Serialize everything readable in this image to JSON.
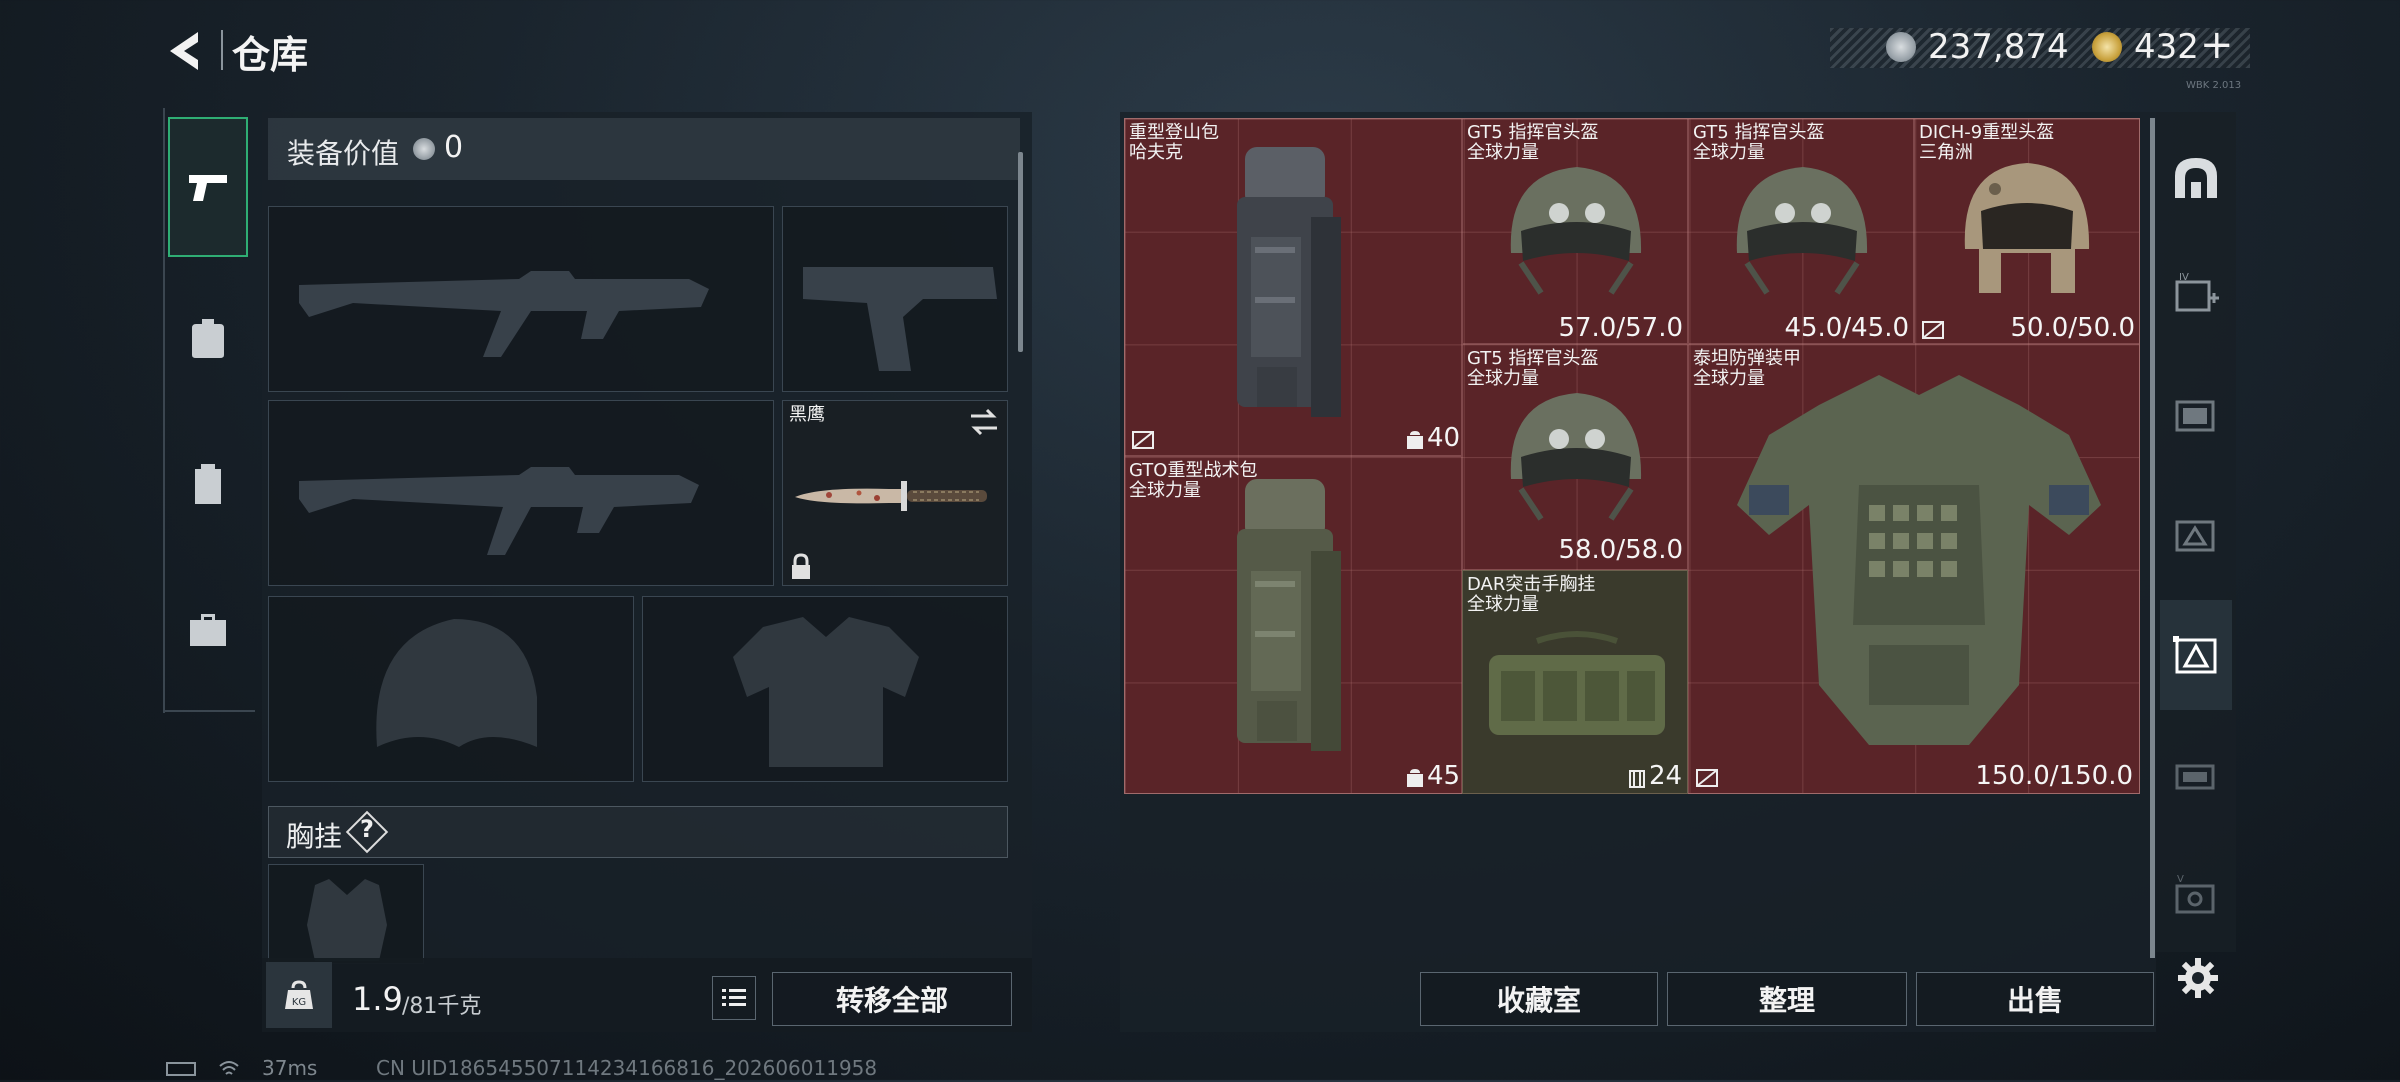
{
  "header": {
    "title": "仓库",
    "currency1": "237,874",
    "currency2": "432",
    "add_symbol": "+",
    "version_text": "WBK 2.013"
  },
  "loadout": {
    "equipment_value_label": "装备价值",
    "equipment_value": "0",
    "knife_name": "黑鹰",
    "chest_rig_label": "胸挂",
    "help_symbol": "?"
  },
  "weight": {
    "current": "1.9",
    "max": "/81千克"
  },
  "buttons": {
    "transfer_all": "转移全部",
    "collection_room": "收藏室",
    "organize": "整理",
    "sell": "出售"
  },
  "stash_items": [
    {
      "name1": "重型登山包",
      "name2": "哈夫克",
      "count": "40"
    },
    {
      "name1": "GT5 指挥官头盔",
      "name2": "全球力量",
      "durability": "57.0/57.0"
    },
    {
      "name1": "GT5 指挥官头盔",
      "name2": "全球力量",
      "durability": "45.0/45.0"
    },
    {
      "name1": "DICH-9重型头盔",
      "name2": "三角洲",
      "durability": "50.0/50.0"
    },
    {
      "name1": "GT5 指挥官头盔",
      "name2": "全球力量",
      "durability": "58.0/58.0"
    },
    {
      "name1": "泰坦防弹装甲",
      "name2": "全球力量",
      "durability": "150.0/150.0"
    },
    {
      "name1": "GTO重型战术包",
      "name2": "全球力量",
      "count": "45"
    },
    {
      "name1": "DAR突击手胸挂",
      "name2": "全球力量",
      "count": "24"
    }
  ],
  "status": {
    "ping": "37ms",
    "uid": "CN UID18654550711423416681​6_202606011958"
  },
  "colors": {
    "item_bg": "#5a2428",
    "item_bg_alt": "#3a3a2c",
    "accent_green": "#2fae74"
  }
}
